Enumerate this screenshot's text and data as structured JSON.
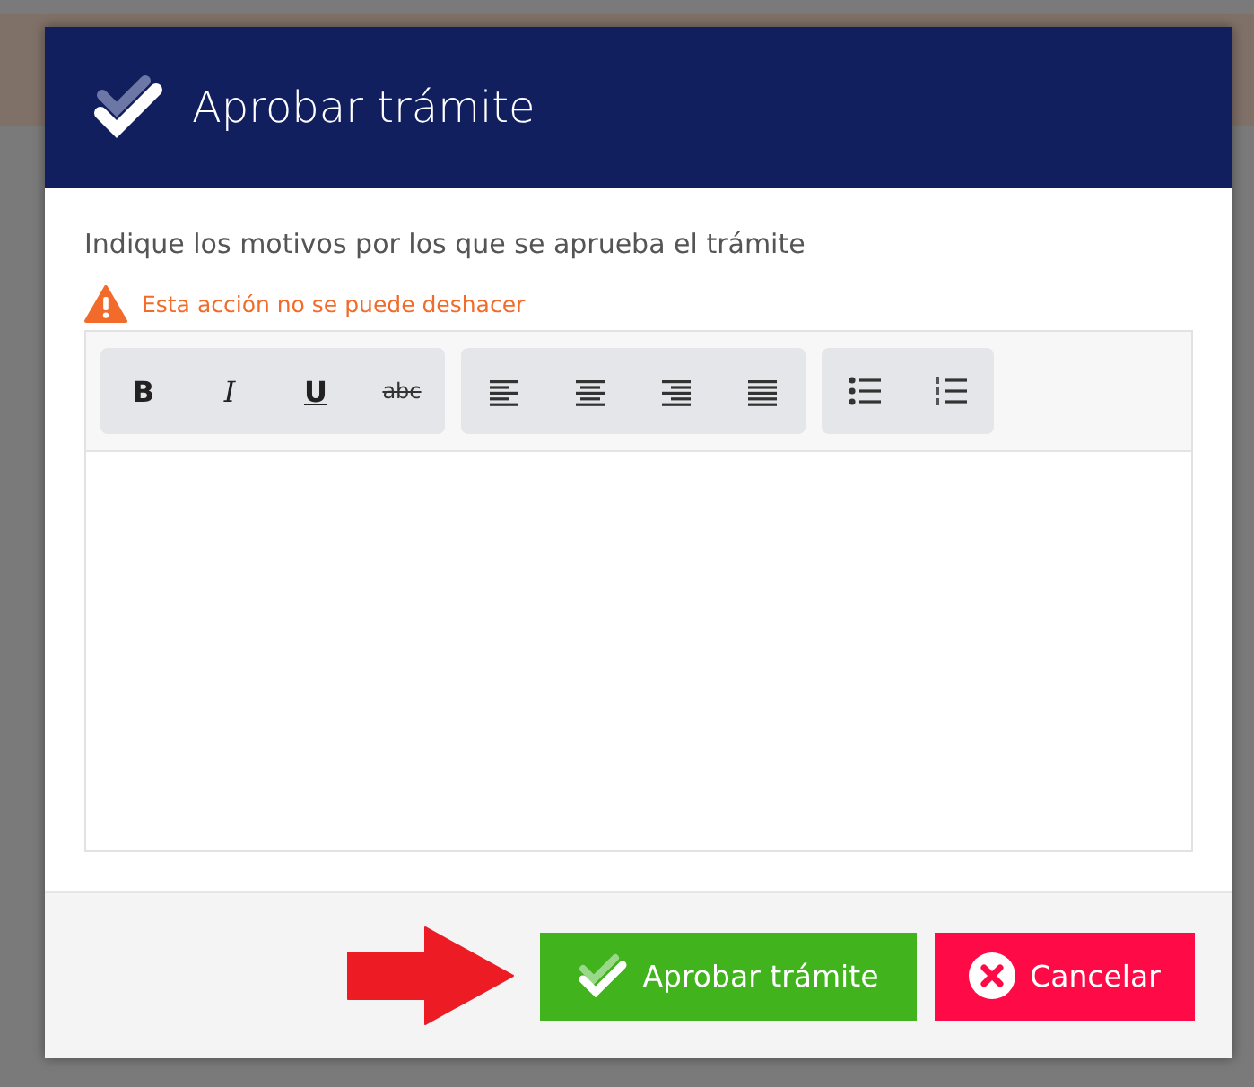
{
  "dialog": {
    "title": "Aprobar trámite",
    "prompt": "Indique los motivos por los que se aprueba el trámite",
    "warning": "Esta acción no se puede deshacer",
    "toolbar": [
      {
        "buttons": [
          {
            "kind": "bold",
            "label": "B"
          },
          {
            "kind": "italic",
            "label": "I"
          },
          {
            "kind": "underline",
            "label": "U"
          },
          {
            "kind": "strike",
            "label": "abc"
          }
        ]
      },
      {
        "buttons": [
          {
            "kind": "align-left"
          },
          {
            "kind": "align-center"
          },
          {
            "kind": "align-right"
          },
          {
            "kind": "justify"
          }
        ]
      },
      {
        "buttons": [
          {
            "kind": "bullet-list"
          },
          {
            "kind": "numbered-list"
          }
        ]
      }
    ],
    "buttons": [
      {
        "kind": "approve",
        "label": "Aprobar trámite"
      },
      {
        "kind": "cancel",
        "label": "Cancelar"
      }
    ]
  }
}
